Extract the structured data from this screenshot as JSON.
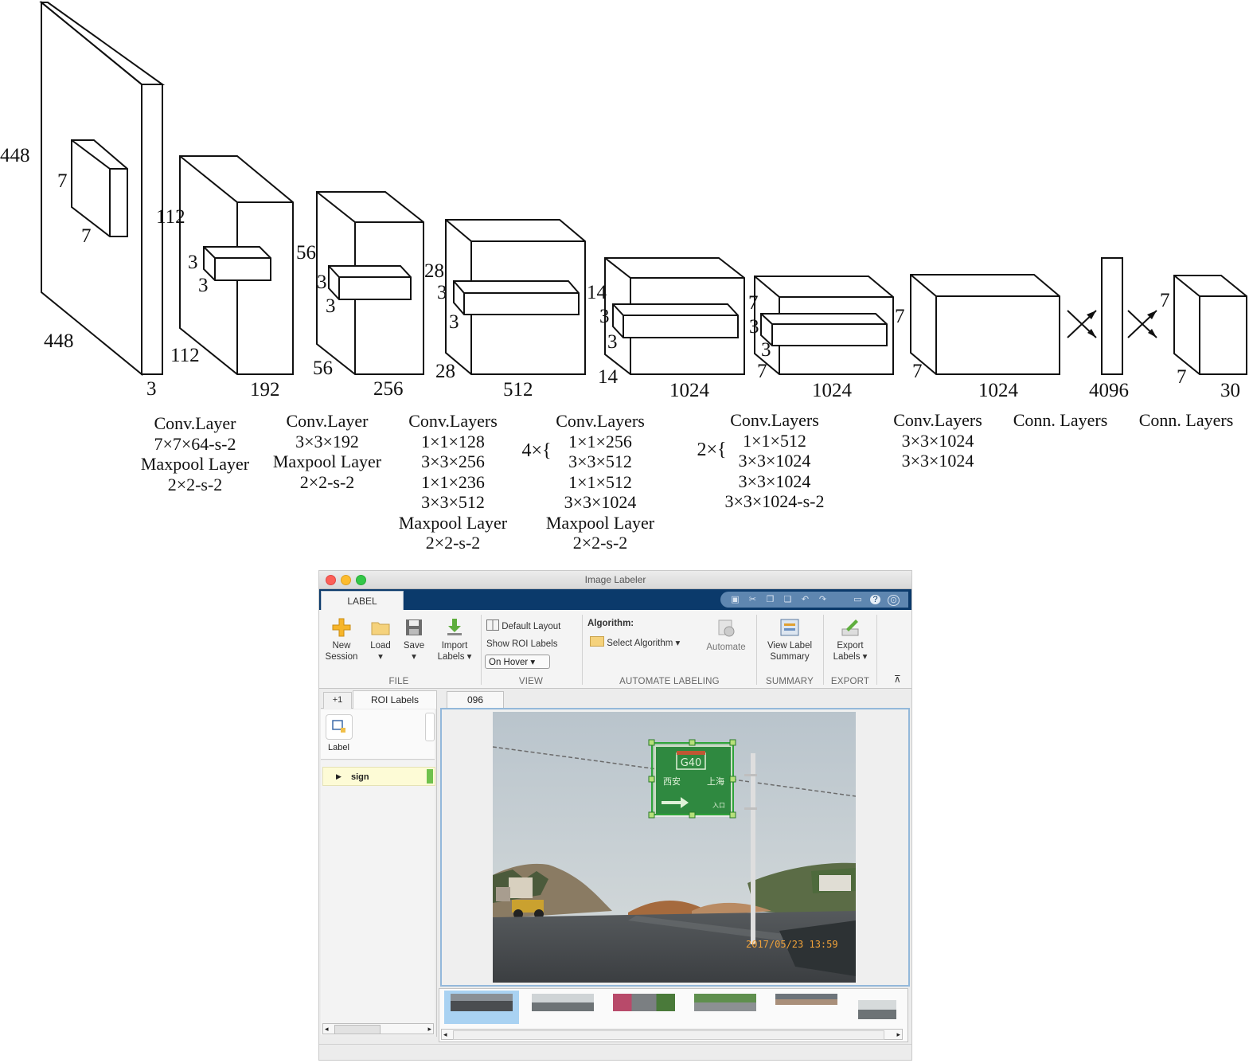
{
  "network": {
    "blocks": [
      {
        "outer_h": "448",
        "outer_w": "448",
        "outer_d": "3",
        "kernel_a": "7",
        "kernel_b": "7"
      },
      {
        "outer_h": "112",
        "outer_w": "112",
        "outer_d": "192",
        "kernel_a": "3",
        "kernel_b": "3"
      },
      {
        "outer_h": "56",
        "outer_w": "56",
        "outer_d": "256",
        "kernel_a": "3",
        "kernel_b": "3"
      },
      {
        "outer_h": "28",
        "outer_w": "28",
        "outer_d": "512",
        "kernel_a": "3",
        "kernel_b": "3"
      },
      {
        "outer_h": "14",
        "outer_w": "14",
        "outer_d": "1024",
        "kernel_a": "3",
        "kernel_b": "3"
      },
      {
        "outer_h": "7",
        "outer_w": "7",
        "outer_d": "1024",
        "kernel_a": "3",
        "kernel_b": "3"
      },
      {
        "outer_h": "7",
        "outer_w": "7",
        "outer_d": "1024"
      },
      {
        "outer_d": "4096"
      },
      {
        "outer_h": "7",
        "outer_w": "7",
        "outer_d": "30"
      }
    ],
    "captions": [
      {
        "lines": [
          "Conv.Layer",
          "7×7×64-s-2",
          "Maxpool Layer",
          "2×2-s-2"
        ]
      },
      {
        "lines": [
          "Conv.Layer",
          "3×3×192",
          "Maxpool Layer",
          "2×2-s-2"
        ]
      },
      {
        "lines": [
          "Conv.Layers",
          "1×1×128",
          "3×3×256",
          "1×1×236",
          "3×3×512",
          "Maxpool Layer",
          "2×2-s-2"
        ]
      },
      {
        "repeat": "4×{",
        "lines": [
          "Conv.Layers",
          "1×1×256",
          "3×3×512",
          "1×1×512",
          "3×3×1024",
          "Maxpool Layer",
          "2×2-s-2"
        ]
      },
      {
        "repeat": "2×{",
        "lines": [
          "Conv.Layers",
          "1×1×512",
          "3×3×1024",
          "3×3×1024",
          "3×3×1024-s-2"
        ]
      },
      {
        "lines": [
          "Conv.Layers",
          "3×3×1024",
          "3×3×1024"
        ]
      },
      {
        "lines": [
          "Conn. Layers"
        ]
      },
      {
        "lines": [
          "Conn. Layers"
        ]
      }
    ]
  },
  "app": {
    "window_title": "Image Labeler",
    "tab_label": "LABEL",
    "ribbon": {
      "new_session": "New\nSession",
      "new_session_l1": "New",
      "new_session_l2": "Session",
      "load": "Load",
      "save": "Save",
      "import_l1": "Import",
      "import_l2": "Labels ▾",
      "file_group": "FILE",
      "default_layout": "Default Layout",
      "show_roi_labels": "Show ROI Labels",
      "on_hover": "On Hover ▾",
      "view_group": "VIEW",
      "algorithm_label": "Algorithm:",
      "select_algorithm": "Select Algorithm ▾",
      "automate": "Automate",
      "automate_group": "AUTOMATE LABELING",
      "view_label_l1": "View Label",
      "view_label_l2": "Summary",
      "summary_group": "SUMMARY",
      "export_l1": "Export",
      "export_l2": "Labels ▾",
      "export_group": "EXPORT"
    },
    "left_panel": {
      "tab_plus": "+1",
      "tab_roi": "ROI Labels",
      "label_button": "Label",
      "sign_item": "sign"
    },
    "doc_tab": "096",
    "photo": {
      "sign_route": "G40",
      "sign_left": "西安",
      "sign_right": "上海",
      "sign_entry": "入口",
      "timestamp": "2017/05/23 13:59"
    }
  },
  "colors": {
    "tab_strip": "#0b3a6b",
    "roi_box": "#2fa43a",
    "sign_panel": "#1e7a3d",
    "sign_highlight": "#fdfbd6"
  }
}
